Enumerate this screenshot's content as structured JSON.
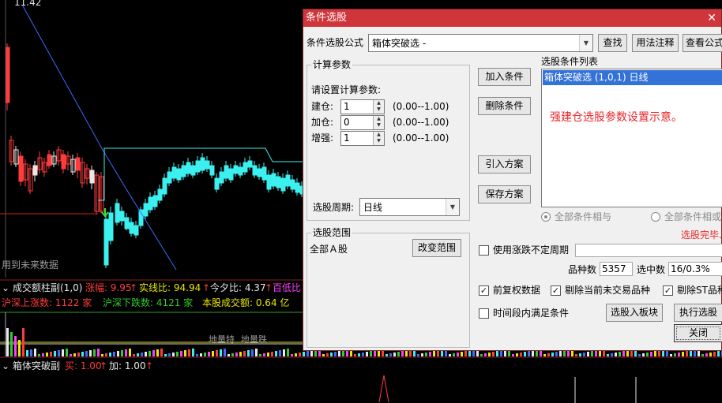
{
  "chart": {
    "top_price": "11.42",
    "future_data_note": "用到未来数据",
    "volume_panel": {
      "title": "成交额柱副(1,0)",
      "amplitude": "涨幅: 9.95",
      "real_ratio": "实线比: 94.94",
      "today_vs_yesterday": "今夕比: 4.37",
      "hundred_low": "百低比",
      "up_count": "沪深上涨数:  1122 家",
      "down_count": "沪深下跌数:  4121 家",
      "turnover": "本股成交额:  0.64 亿",
      "tag_a": "地量特",
      "tag_b": "地量跌"
    },
    "box_panel": {
      "title": "箱体突破副",
      "buy": "买: 1.00",
      "add": "加: 1.00"
    },
    "colors": {
      "up": "#ff3c3c",
      "down": "#3cf0f0",
      "ma": "#3a6cff",
      "limit_line": "#d02020",
      "box_line": "#3cf0f0"
    }
  },
  "dialog": {
    "title": "条件选股",
    "formula_label": "条件选股公式",
    "formula_value": "箱体突破选  -",
    "find_button": "查找",
    "usage_button": "用法注释",
    "view_formula_button": "查看公式",
    "calc_params_group": "计算参数",
    "params_prompt": "请设置计算参数:",
    "params": [
      {
        "label": "建仓:",
        "value": "1",
        "range": "(0.00--1.00)"
      },
      {
        "label": "加仓:",
        "value": "0",
        "range": "(0.00--1.00)"
      },
      {
        "label": "增强:",
        "value": "1",
        "range": "(0.00--1.00)"
      }
    ],
    "period_label": "选股周期:",
    "period_value": "日线",
    "add_condition_button": "加入条件",
    "delete_condition_button": "删除条件",
    "import_plan_button": "引入方案",
    "save_plan_button": "保存方案",
    "condition_list_label": "选股条件列表",
    "condition_item": "箱体突破选 (1,0,1) 日线",
    "note": "强建仓选股参数设置示意。",
    "radio_and": "全部条件相与",
    "radio_or": "全部条件相或",
    "status": "选股完毕.",
    "scope_group": "选股范围",
    "scope_value": "全部Ａ股",
    "change_scope_button": "改变范围",
    "use_period_label": "使用涨跌不定周期",
    "count_label": "品种数",
    "count_value": "5357",
    "selected_label": "选中数",
    "selected_value": "16/0.3%",
    "adjusted_label": "前复权数据",
    "exclude_untraded_label": "剔除当前未交易品种",
    "exclude_st_label": "剔除ST品种",
    "within_period_label": "时间段内满足条件",
    "to_sector_button": "选股入板块",
    "execute_button": "执行选股",
    "close_button": "关闭"
  }
}
